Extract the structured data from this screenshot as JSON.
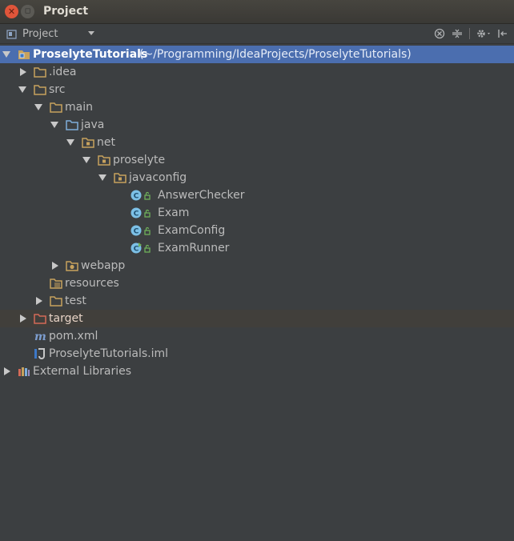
{
  "window": {
    "title": "Project"
  },
  "toolbar": {
    "view_label": "Project",
    "icons": [
      "locate-icon",
      "collapse-all-icon",
      "gear-icon",
      "hide-icon"
    ]
  },
  "tree": {
    "root": {
      "name": "ProselyteTutorials",
      "path": "(~/Programming/IdeaProjects/ProselyteTutorials)"
    },
    "idea": ".idea",
    "src": "src",
    "main": "main",
    "java": "java",
    "net": "net",
    "proselyte": "proselyte",
    "javaconfig": "javaconfig",
    "classes": [
      "AnswerChecker",
      "Exam",
      "ExamConfig",
      "ExamRunner"
    ],
    "webapp": "webapp",
    "resources": "resources",
    "test": "test",
    "target": "target",
    "pom": "pom.xml",
    "iml": "ProselyteTutorials.iml",
    "external": "External Libraries"
  },
  "colors": {
    "background": "#3c3f41",
    "selection": "#4b6eaf",
    "folder": "#c7a25d",
    "source_folder": "#7eaedb",
    "excluded_folder": "#d46a57",
    "class_icon": "#7cc0e6"
  }
}
